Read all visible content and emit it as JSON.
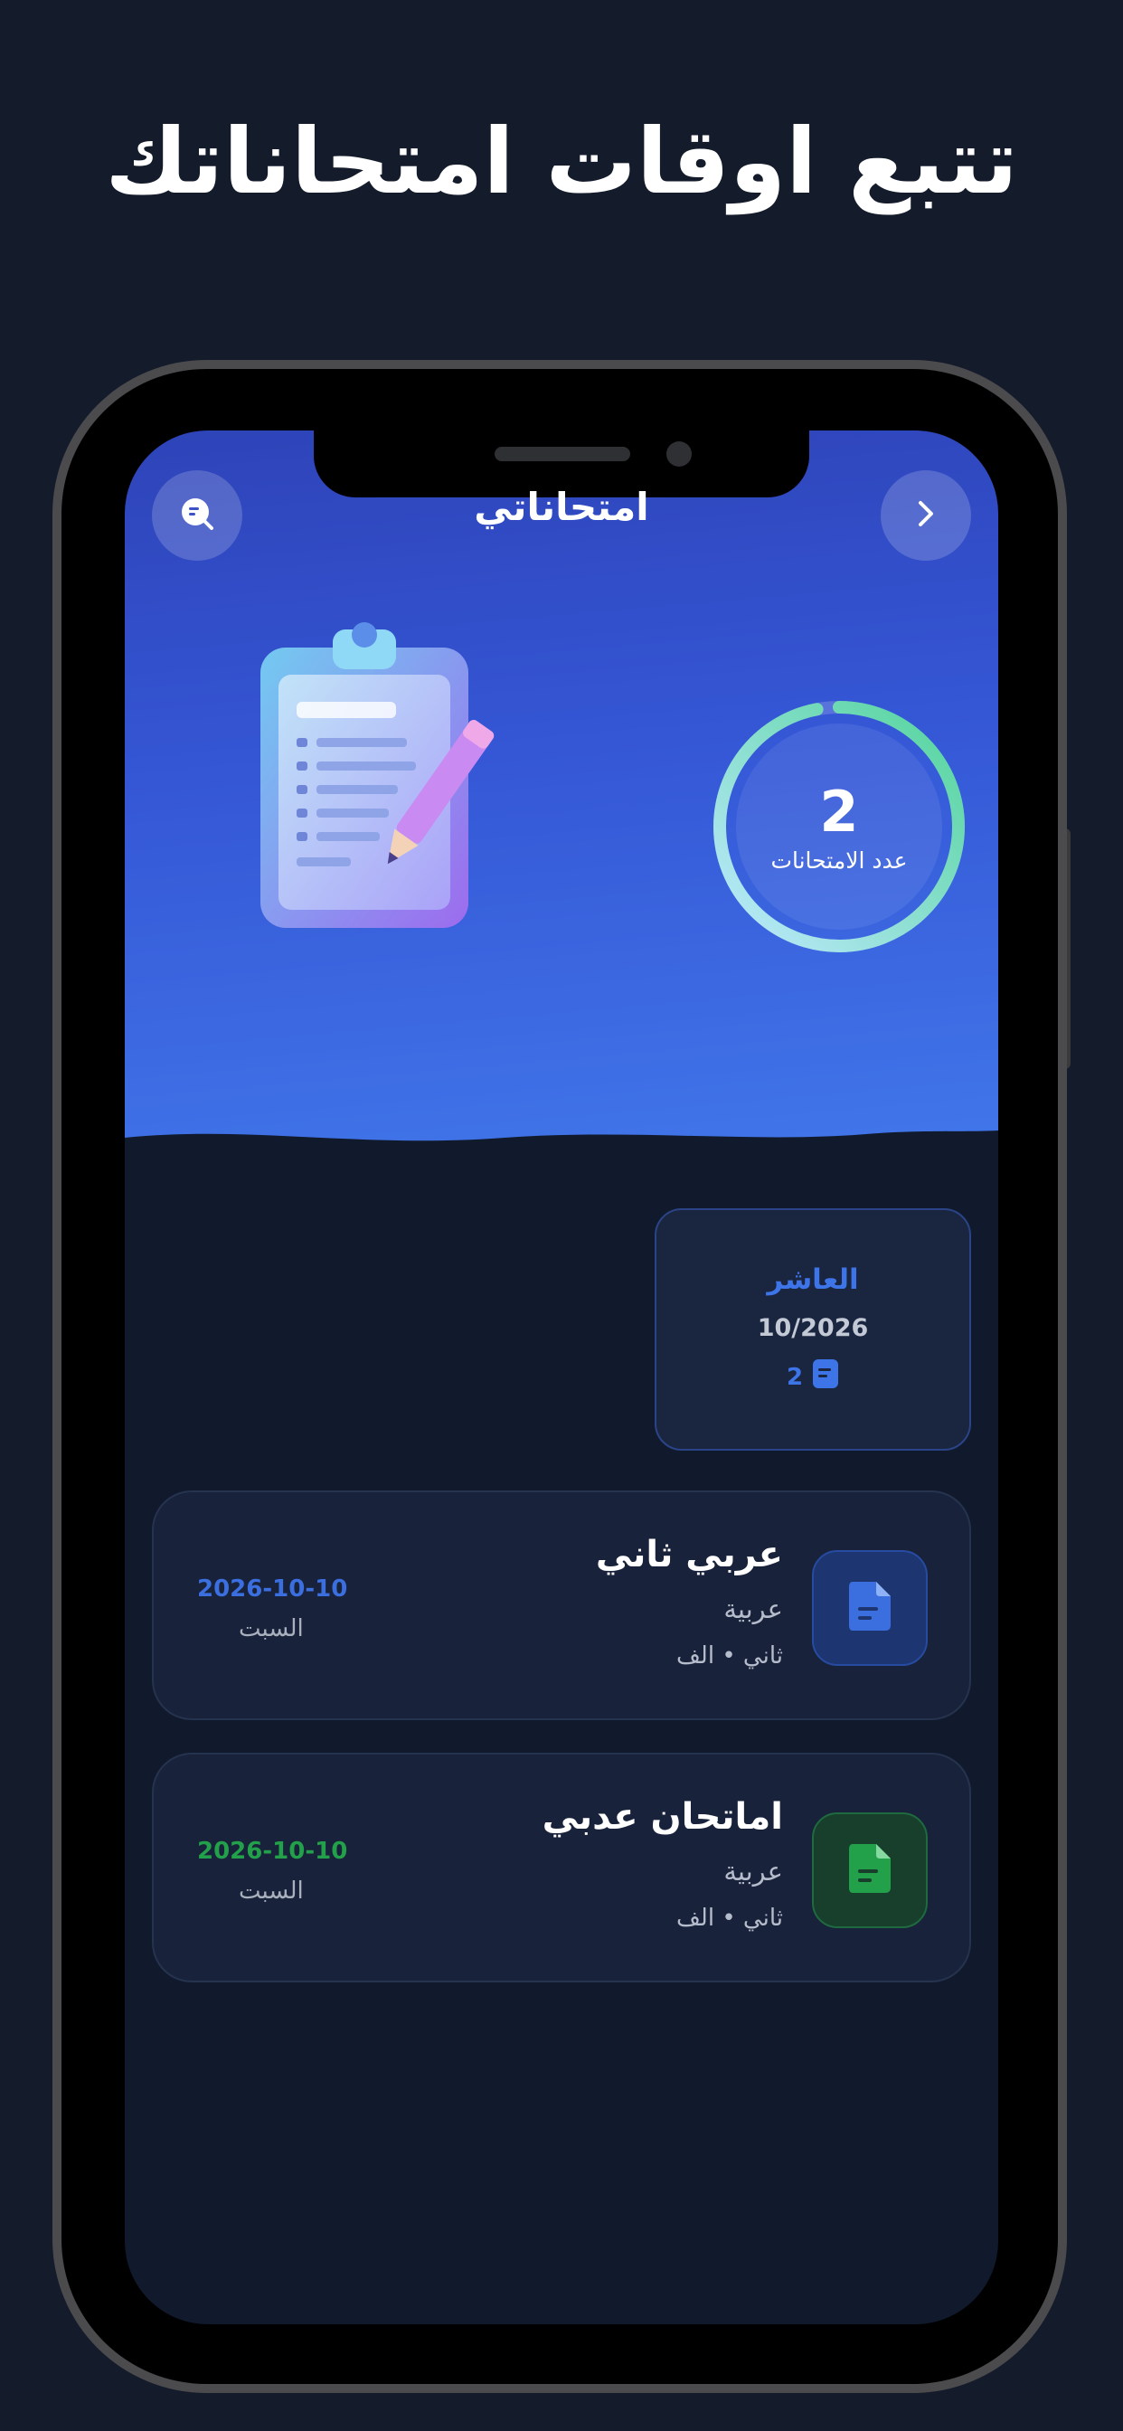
{
  "headline": "تتبع اوقات امتحاناتك",
  "header": {
    "title": "امتحاناتي",
    "left_icon": "search-chat-icon",
    "right_icon": "chevron-right-icon"
  },
  "stats": {
    "count": "2",
    "label": "عدد الامتحانات",
    "ring_progress": 0.97
  },
  "month_card": {
    "name": "العاشر",
    "date": "10/2026",
    "count": "2"
  },
  "exams": [
    {
      "title": "عربي ثاني",
      "subject": "عربية",
      "class": "ثاني • الف",
      "date": "2026-10-10",
      "day": "السبت",
      "color": "#3b6fe0",
      "icon": "document-icon"
    },
    {
      "title": "اماتحان عدبي",
      "subject": "عربية",
      "class": "ثاني • الف",
      "date": "2026-10-10",
      "day": "السبت",
      "color": "#22a04a",
      "icon": "document-icon"
    }
  ],
  "colors": {
    "background": "#141b2b",
    "accent_blue": "#3d74e8",
    "accent_green": "#22a04a"
  }
}
